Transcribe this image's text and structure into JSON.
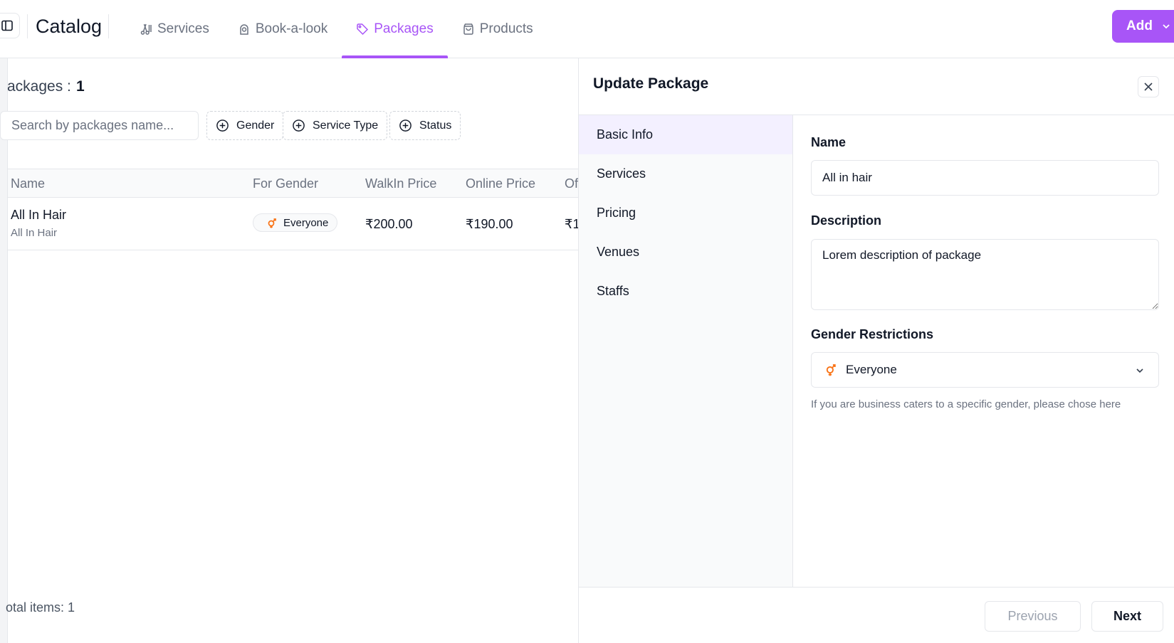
{
  "app": {
    "title": "Catalog"
  },
  "nav": {
    "tabs": [
      {
        "label": "Services",
        "icon": "scissors-icon",
        "active": false
      },
      {
        "label": "Book-a-look",
        "icon": "look-icon",
        "active": false
      },
      {
        "label": "Packages",
        "icon": "tag-icon",
        "active": true
      },
      {
        "label": "Products",
        "icon": "shopping-bag-icon",
        "active": false
      }
    ],
    "add_label": "Add"
  },
  "packages": {
    "count_label": "ackages :",
    "count_value": "1",
    "search_placeholder": "Search by packages name...",
    "filters": [
      "Gender",
      "Service Type",
      "Status"
    ],
    "columns": [
      "Name",
      "For Gender",
      "WalkIn Price",
      "Online Price",
      "Of"
    ],
    "rows": [
      {
        "name": "All In Hair",
        "subtitle": "All In Hair",
        "gender": "Everyone",
        "walkin_price": "₹200.00",
        "online_price": "₹190.00",
        "offer_price": "₹1"
      }
    ],
    "total_items": "otal items: 1"
  },
  "drawer": {
    "title": "Update Package",
    "steps": [
      {
        "label": "Basic Info",
        "active": true
      },
      {
        "label": "Services",
        "active": false
      },
      {
        "label": "Pricing",
        "active": false
      },
      {
        "label": "Venues",
        "active": false
      },
      {
        "label": "Staffs",
        "active": false
      }
    ],
    "form": {
      "name_label": "Name",
      "name_value": "All in hair",
      "description_label": "Description",
      "description_value": "Lorem description of package",
      "gender_label": "Gender Restrictions",
      "gender_value": "Everyone",
      "gender_help": "If you are business caters to a specific gender, please chose here"
    },
    "footer": {
      "previous_label": "Previous",
      "next_label": "Next"
    }
  },
  "colors": {
    "accent": "#a855f7",
    "gender_icon": "#f97316"
  }
}
